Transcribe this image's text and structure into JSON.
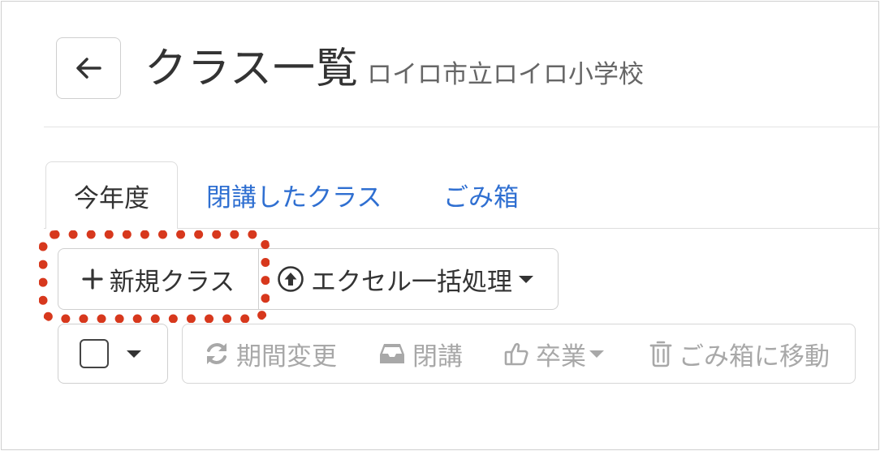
{
  "header": {
    "title": "クラス一覧",
    "subtitle": "ロイロ市立ロイロ小学校",
    "back_icon": "arrow-left-icon"
  },
  "tabs": [
    {
      "label": "今年度",
      "active": true
    },
    {
      "label": "閉講したクラス",
      "active": false
    },
    {
      "label": "ごみ箱",
      "active": false
    }
  ],
  "toolbar": {
    "new_class_label": "新規クラス",
    "excel_bulk_label": "エクセル一括処理"
  },
  "bulk_actions": {
    "change_period": "期間変更",
    "close_course": "閉講",
    "graduate": "卒業",
    "move_to_trash": "ごみ箱に移動"
  },
  "colors": {
    "link": "#2f6fd1",
    "highlight": "#d7381d",
    "disabled_text": "#a8a8a8"
  }
}
